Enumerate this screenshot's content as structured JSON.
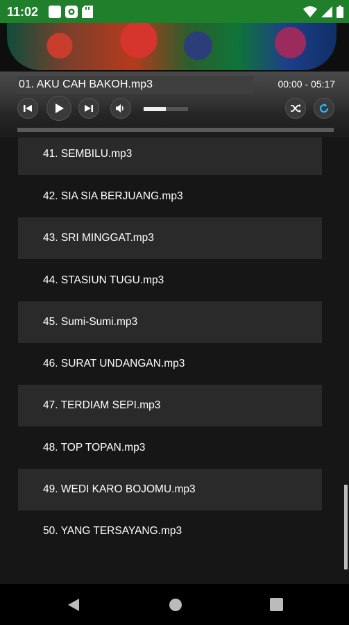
{
  "status_bar": {
    "time": "11:02",
    "left_icons": [
      "square-icon",
      "camera-icon",
      "sd-card-icon"
    ],
    "right_icons": [
      "wifi-icon",
      "signal-icon",
      "battery-icon"
    ]
  },
  "player": {
    "title": "01. AKU CAH BAKOH.mp3",
    "time": "00:00 - 05:17",
    "volume_level": 0.5,
    "progress": 0
  },
  "playlist": [
    "41. SEMBILU.mp3",
    "42. SIA SIA BERJUANG.mp3",
    "43. SRI MINGGAT.mp3",
    "44. STASIUN TUGU.mp3",
    "45. Sumi-Sumi.mp3",
    "46. SURAT UNDANGAN.mp3",
    "47. TERDIAM SEPI.mp3",
    "48. TOP TOPAN.mp3",
    "49. WEDI KARO BOJOMU.mp3",
    "50. YANG TERSAYANG.mp3"
  ],
  "colors": {
    "status_bar": "#1f7f2a",
    "list_background": "#161616",
    "shaded_row": "#2a2a2a",
    "repeat_accent": "#29b6f6"
  }
}
